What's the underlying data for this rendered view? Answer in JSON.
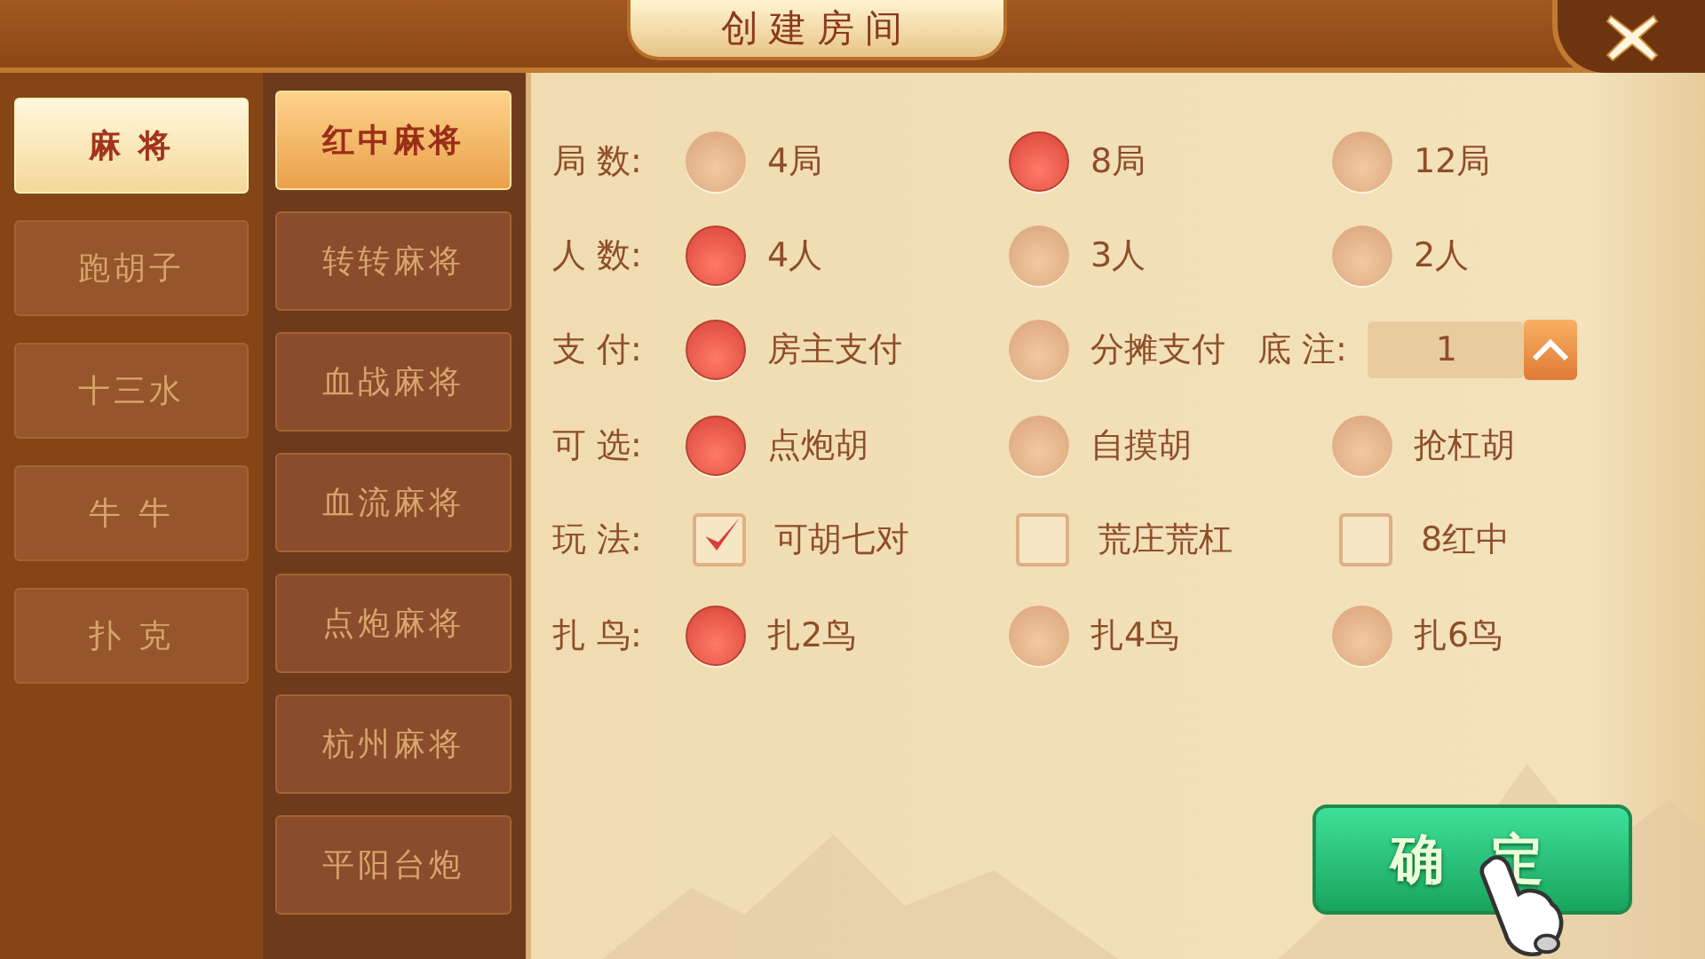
{
  "title": "创建房间",
  "categories": [
    {
      "label": "麻 将",
      "selected": true
    },
    {
      "label": "跑胡子",
      "selected": false
    },
    {
      "label": "十三水",
      "selected": false
    },
    {
      "label": "牛 牛",
      "selected": false
    },
    {
      "label": "扑 克",
      "selected": false
    }
  ],
  "modes": [
    {
      "label": "红中麻将",
      "selected": true
    },
    {
      "label": "转转麻将",
      "selected": false
    },
    {
      "label": "血战麻将",
      "selected": false
    },
    {
      "label": "血流麻将",
      "selected": false
    },
    {
      "label": "点炮麻将",
      "selected": false
    },
    {
      "label": "杭州麻将",
      "selected": false
    },
    {
      "label": "平阳台炮",
      "selected": false
    }
  ],
  "settings": [
    {
      "label": "局 数:",
      "kind": "radio",
      "options": [
        {
          "text": "4局",
          "selected": false
        },
        {
          "text": "8局",
          "selected": true
        },
        {
          "text": "12局",
          "selected": false
        }
      ]
    },
    {
      "label": "人 数:",
      "kind": "radio",
      "options": [
        {
          "text": "4人",
          "selected": true
        },
        {
          "text": "3人",
          "selected": false
        },
        {
          "text": "2人",
          "selected": false
        }
      ]
    },
    {
      "label": "支 付:",
      "kind": "radio",
      "options": [
        {
          "text": "房主支付",
          "selected": true
        },
        {
          "text": "分摊支付",
          "selected": false
        }
      ],
      "stake": {
        "label": "底 注:",
        "value": "1"
      }
    },
    {
      "label": "可 选:",
      "kind": "radio",
      "options": [
        {
          "text": "点炮胡",
          "selected": true
        },
        {
          "text": "自摸胡",
          "selected": false
        },
        {
          "text": "抢杠胡",
          "selected": false
        }
      ]
    },
    {
      "label": "玩 法:",
      "kind": "checkbox",
      "options": [
        {
          "text": "可胡七对",
          "checked": true
        },
        {
          "text": "荒庄荒杠",
          "checked": false
        },
        {
          "text": "8红中",
          "checked": false
        }
      ]
    },
    {
      "label": "扎 鸟:",
      "kind": "radio",
      "options": [
        {
          "text": "扎2鸟",
          "selected": true
        },
        {
          "text": "扎4鸟",
          "selected": false
        },
        {
          "text": "扎6鸟",
          "selected": false
        }
      ]
    }
  ],
  "confirm_button": "确定"
}
